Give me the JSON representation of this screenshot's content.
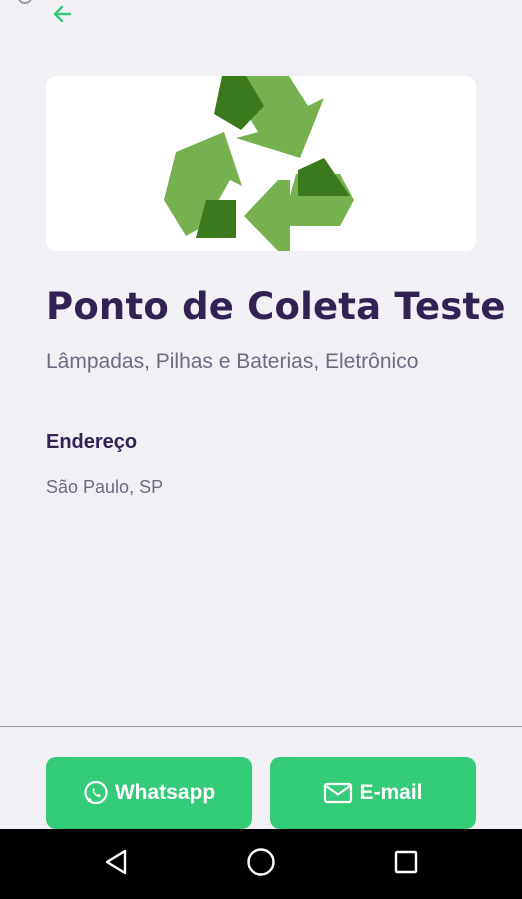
{
  "header": {
    "back_icon": "arrow-left-icon"
  },
  "point": {
    "image_icon": "recycle-icon",
    "title": "Ponto de Coleta Teste",
    "items": "Lâmpadas, Pilhas e Baterias, Eletrônico",
    "address_label": "Endereço",
    "address_value": "São Paulo, SP"
  },
  "footer": {
    "whatsapp_label": "Whatsapp",
    "whatsapp_icon": "whatsapp-icon",
    "email_label": "E-mail",
    "email_icon": "mail-icon"
  },
  "system_nav": {
    "back_icon": "triangle-back-icon",
    "home_icon": "circle-home-icon",
    "recent_icon": "square-recents-icon"
  },
  "colors": {
    "accent": "#34cb79",
    "title": "#322153",
    "text": "#6c6c80",
    "background": "#f0f0f5",
    "recycle_light": "#76b150",
    "recycle_dark": "#3a7a1c"
  }
}
